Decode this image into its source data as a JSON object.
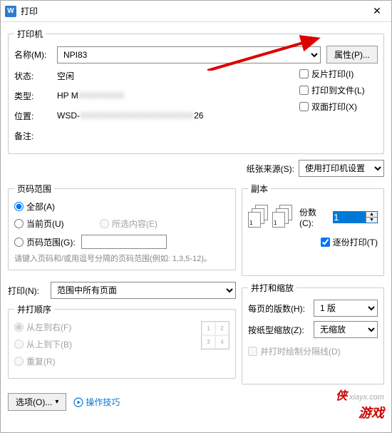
{
  "window": {
    "title": "打印"
  },
  "printer": {
    "legend": "打印机",
    "name_label": "名称(M):",
    "name_value": "NPI83",
    "properties_btn": "属性(P)...",
    "status_label": "状态:",
    "status_value": "空闲",
    "type_label": "类型:",
    "type_value": "HP M",
    "location_label": "位置:",
    "location_value": "WSD-",
    "location_value_end": "26",
    "comment_label": "备注:",
    "reverse_chk": "反片打印(I)",
    "tofile_chk": "打印到文件(L)",
    "duplex_chk": "双面打印(X)"
  },
  "paper": {
    "source_label": "纸张来源(S):",
    "source_value": "使用打印机设置"
  },
  "range": {
    "legend": "页码范围",
    "all": "全部(A)",
    "current": "当前页(U)",
    "selection": "所选内容(E)",
    "pages": "页码范围(G):",
    "hint": "请键入页码和/或用逗号分隔的页码范围(例如: 1,3,5-12)。"
  },
  "copies": {
    "legend": "副本",
    "count_label": "份数(C):",
    "count_value": "1",
    "collate": "逐份打印(T)"
  },
  "printwhat": {
    "label": "打印(N):",
    "value": "范围中所有页面"
  },
  "order": {
    "legend": "并打顺序",
    "ltr": "从左到右(F)",
    "ttb": "从上到下(B)",
    "repeat": "重复(R)"
  },
  "scale": {
    "legend": "并打和缩放",
    "perpage_label": "每页的版数(H):",
    "perpage_value": "1 版",
    "bypaper_label": "按纸型缩放(Z):",
    "bypaper_value": "无缩放",
    "drawline": "并打时绘制分隔线(D)"
  },
  "footer": {
    "options_btn": "选项(O)...",
    "tips": "操作技巧"
  },
  "watermark": {
    "line1": "xiayx.com",
    "line2": "游戏"
  }
}
